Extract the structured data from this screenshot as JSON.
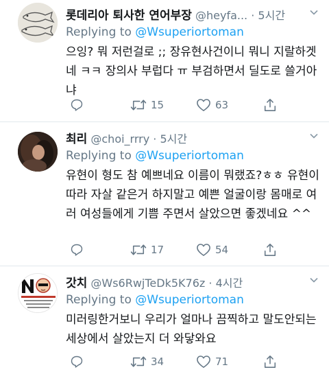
{
  "reply_prefix": "Replying to",
  "tweets": [
    {
      "name": "롯데리아 퇴사한 연어부장",
      "handle": "@heyfa...",
      "sep": "·",
      "time": "5시간",
      "mention": "@Wsuperiortoman",
      "text": "으잉? 뭐 저런걸로 ;; 장유현사건이니 뭐니 지랄하겟네 ㅋㅋ 장의사 부럽다 ㅠ 부검하면서 딜도로 쓸거아냐",
      "retweets": "15",
      "likes": "63"
    },
    {
      "name": "최리",
      "handle": "@choi_rrry",
      "sep": "·",
      "time": "5시간",
      "mention": "@Wsuperiortoman",
      "text": "유현이 형도 참 예쁘네요 이름이 뭐랬죠?ㅎㅎ 유현이 따라 자살 같은거 하지말고 예쁜 얼굴이랑 몸매로 여러 여성들에게 기쁨 주면서 살았으면 좋겠네요 ^^",
      "retweets": "17",
      "likes": "54"
    },
    {
      "name": "갓치",
      "handle": "@Ws6RwjTeDk5K76z",
      "sep": "·",
      "time": "4시간",
      "mention": "@Wsuperiortoman",
      "text": "미러링한거보니 우리가 얼마나 끔찍하고 말도안되는 세상에서 살았는지 더 와닿와요",
      "retweets": "34",
      "likes": "71"
    }
  ],
  "colors": {
    "link": "#1da1f2",
    "secondary": "#657786",
    "divider": "#e1e8ed"
  }
}
